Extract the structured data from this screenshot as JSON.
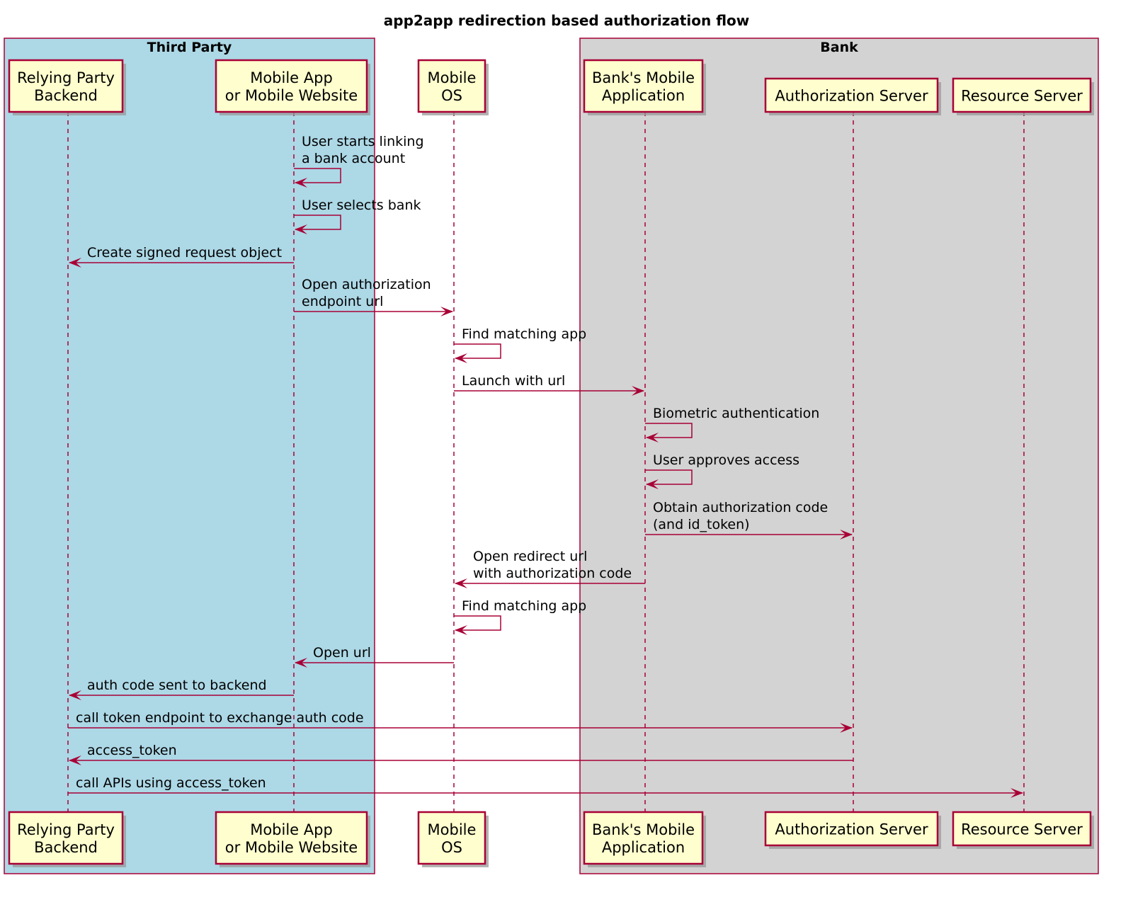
{
  "title": "app2app redirection based authorization flow",
  "colors": {
    "line": "#A80036",
    "participant_fill": "#FEFECE",
    "third_party_fill": "#ADD8E6",
    "bank_fill": "#D3D3D3"
  },
  "groups": [
    {
      "id": "third_party",
      "label": "Third Party",
      "members": [
        "rp_backend",
        "mobile_app"
      ]
    },
    {
      "id": "bank",
      "label": "Bank",
      "members": [
        "bank_app",
        "auth_server",
        "resource_server"
      ]
    }
  ],
  "participants": [
    {
      "id": "rp_backend",
      "lines": [
        "Relying Party",
        "Backend"
      ]
    },
    {
      "id": "mobile_app",
      "lines": [
        "Mobile App",
        "or Mobile Website"
      ]
    },
    {
      "id": "mobile_os",
      "lines": [
        "Mobile",
        "OS"
      ]
    },
    {
      "id": "bank_app",
      "lines": [
        "Bank's Mobile",
        "Application"
      ]
    },
    {
      "id": "auth_server",
      "lines": [
        "Authorization Server"
      ]
    },
    {
      "id": "resource_server",
      "lines": [
        "Resource Server"
      ]
    }
  ],
  "messages": [
    {
      "from": "mobile_app",
      "to": "mobile_app",
      "lines": [
        "User starts linking",
        "a bank account"
      ]
    },
    {
      "from": "mobile_app",
      "to": "mobile_app",
      "lines": [
        "User selects bank"
      ]
    },
    {
      "from": "mobile_app",
      "to": "rp_backend",
      "lines": [
        "Create signed request object"
      ]
    },
    {
      "from": "mobile_app",
      "to": "mobile_os",
      "lines": [
        "Open authorization",
        "endpoint url"
      ]
    },
    {
      "from": "mobile_os",
      "to": "mobile_os",
      "lines": [
        "Find matching app"
      ]
    },
    {
      "from": "mobile_os",
      "to": "bank_app",
      "lines": [
        "Launch with url"
      ]
    },
    {
      "from": "bank_app",
      "to": "bank_app",
      "lines": [
        "Biometric authentication"
      ]
    },
    {
      "from": "bank_app",
      "to": "bank_app",
      "lines": [
        "User approves access"
      ]
    },
    {
      "from": "bank_app",
      "to": "auth_server",
      "lines": [
        "Obtain authorization code",
        "(and id_token)"
      ]
    },
    {
      "from": "bank_app",
      "to": "mobile_os",
      "lines": [
        "Open redirect url",
        "with authorization code"
      ]
    },
    {
      "from": "mobile_os",
      "to": "mobile_os",
      "lines": [
        "Find matching app"
      ]
    },
    {
      "from": "mobile_os",
      "to": "mobile_app",
      "lines": [
        "Open url"
      ]
    },
    {
      "from": "mobile_app",
      "to": "rp_backend",
      "lines": [
        "auth code sent to backend"
      ]
    },
    {
      "from": "rp_backend",
      "to": "auth_server",
      "lines": [
        "call token endpoint to exchange auth code"
      ]
    },
    {
      "from": "auth_server",
      "to": "rp_backend",
      "lines": [
        "access_token"
      ]
    },
    {
      "from": "rp_backend",
      "to": "resource_server",
      "lines": [
        "call APIs using access_token"
      ]
    }
  ]
}
